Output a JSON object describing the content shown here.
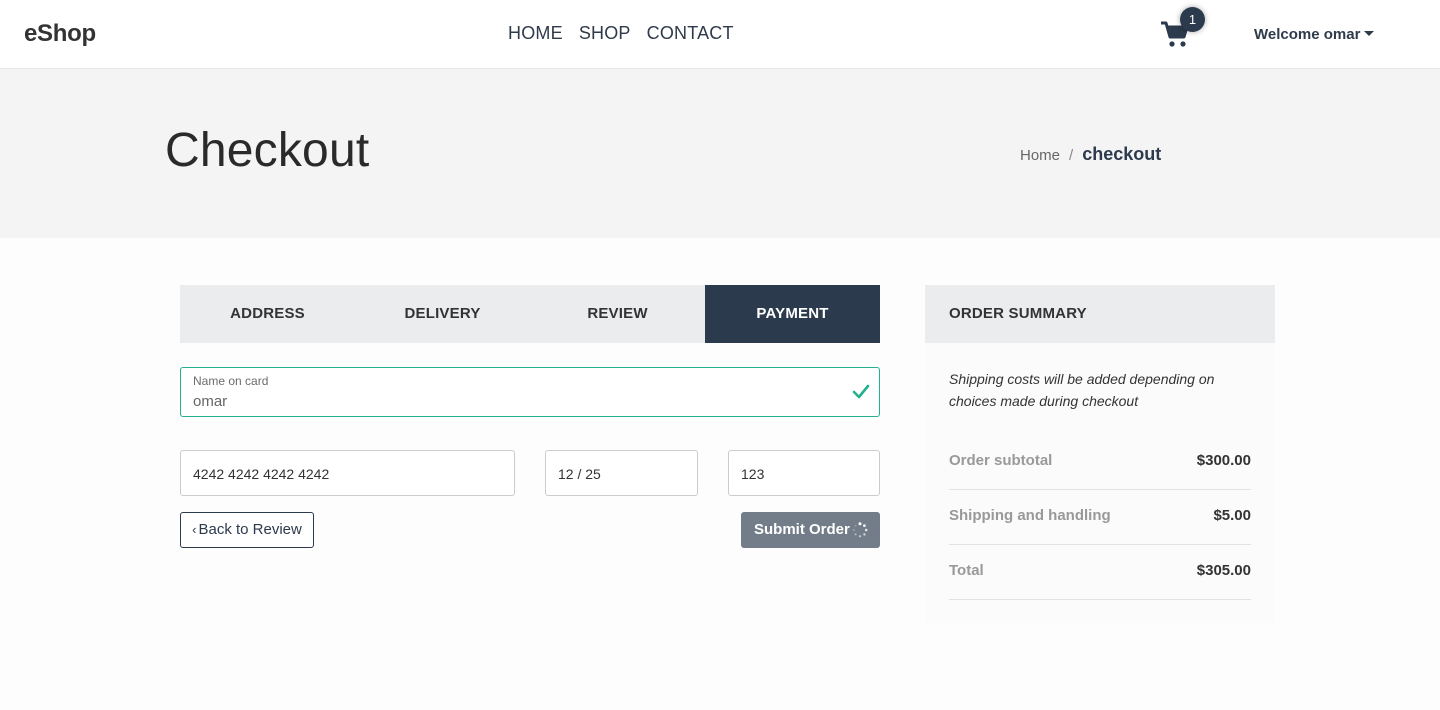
{
  "brand": "eShop",
  "nav": [
    "HOME",
    "SHOP",
    "CONTACT"
  ],
  "cart": {
    "count": "1"
  },
  "user": {
    "greeting": "Welcome omar"
  },
  "page": {
    "title": "Checkout",
    "breadcrumb": {
      "home": "Home",
      "separator": "/",
      "current": "checkout"
    }
  },
  "steps": [
    {
      "label": "ADDRESS",
      "active": false
    },
    {
      "label": "DELIVERY",
      "active": false
    },
    {
      "label": "REVIEW",
      "active": false
    },
    {
      "label": "PAYMENT",
      "active": true
    }
  ],
  "payment": {
    "name_label": "Name on card",
    "name_value": "omar",
    "card_number": "4242 4242 4242 4242",
    "expiry": "12 / 25",
    "cvc": "123",
    "back_label": "Back to Review",
    "submit_label": "Submit Order"
  },
  "summary": {
    "title": "ORDER SUMMARY",
    "note": "Shipping costs will be added depending on choices made during checkout",
    "rows": [
      {
        "label": "Order subtotal",
        "value": "$300.00"
      },
      {
        "label": "Shipping and handling",
        "value": "$5.00"
      },
      {
        "label": "Total",
        "value": "$305.00"
      }
    ]
  },
  "colors": {
    "primary": "#2c3a4d",
    "valid": "#22b08f",
    "submit_disabled": "#737d89"
  }
}
